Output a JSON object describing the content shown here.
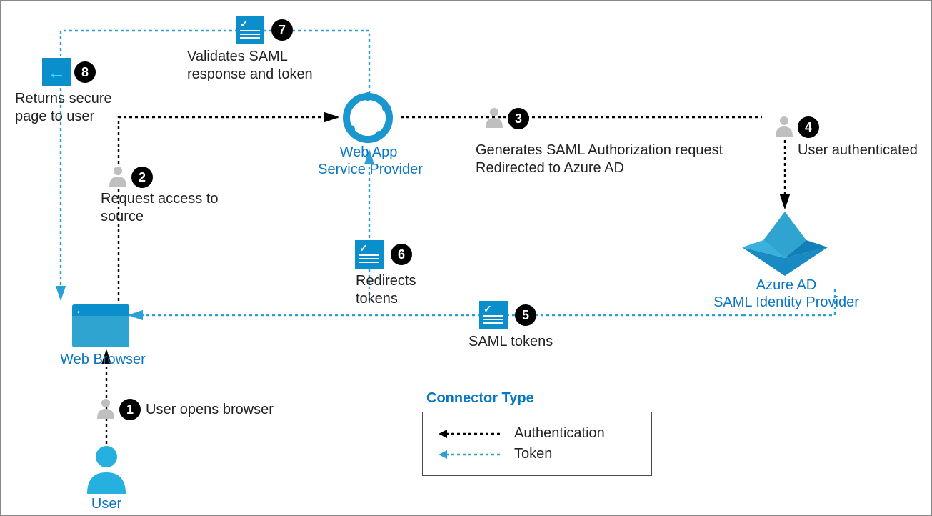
{
  "nodes": {
    "user": {
      "label": "User"
    },
    "browser": {
      "label": "Web Browser"
    },
    "webapp": {
      "label_line1": "Web App",
      "label_line2": "Service Provider"
    },
    "idp": {
      "label_line1": "Azure AD",
      "label_line2": "SAML Identity Provider"
    }
  },
  "steps": {
    "s1": {
      "num": "1",
      "text": "User opens browser"
    },
    "s2": {
      "num": "2",
      "text_line1": "Request access to",
      "text_line2": "source"
    },
    "s3": {
      "num": "3",
      "text_line1": "Generates SAML Authorization request",
      "text_line2": "Redirected to Azure AD"
    },
    "s4": {
      "num": "4",
      "text": "User authenticated"
    },
    "s5": {
      "num": "5",
      "text": "SAML tokens"
    },
    "s6": {
      "num": "6",
      "text_line1": "Redirects",
      "text_line2": "tokens"
    },
    "s7": {
      "num": "7",
      "text_line1": "Validates SAML",
      "text_line2": "response and token"
    },
    "s8": {
      "num": "8",
      "text_line1": "Returns secure",
      "text_line2": "page to user"
    }
  },
  "legend": {
    "title": "Connector Type",
    "auth_label": "Authentication",
    "token_label": "Token"
  },
  "colors": {
    "azure_blue": "#0a8fcc",
    "azure_text": "#0a77c3",
    "black": "#000000",
    "token_line": "#2aa0d6",
    "auth_line": "#000000"
  }
}
